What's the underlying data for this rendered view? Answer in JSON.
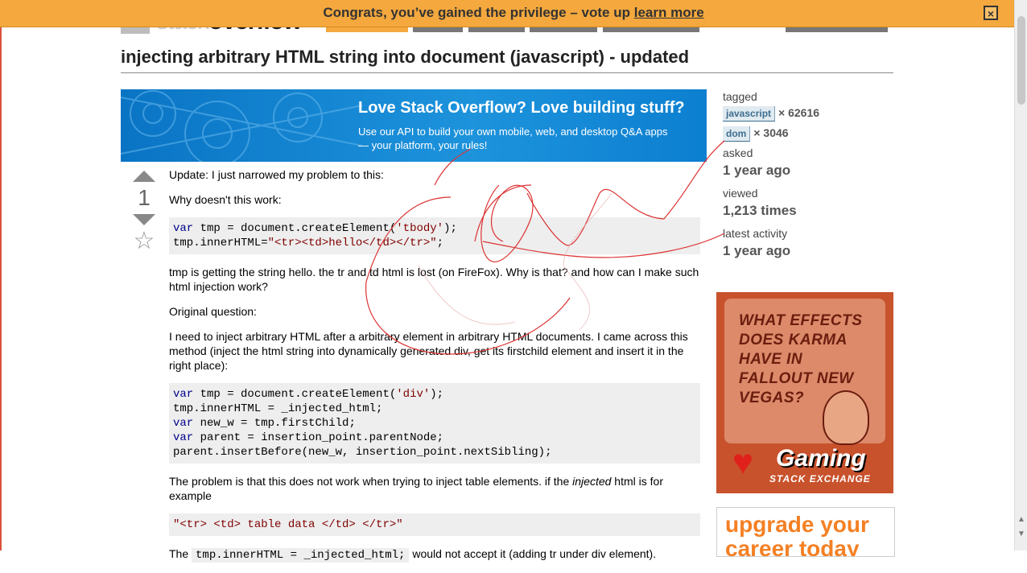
{
  "notification": {
    "message": "Congrats, you’ve gained the privilege – vote up",
    "link": "learn more",
    "close": "×"
  },
  "header": {
    "logo_prefix": "stack",
    "logo_suffix": "overflow"
  },
  "question": {
    "title": "injecting arbitrary HTML string into document (javascript) - updated",
    "votes": "1",
    "star": "☆"
  },
  "banner": {
    "headline": "Love Stack Overflow? Love building stuff?",
    "sub1": "Use our API to build your own mobile, web, and desktop Q&A apps",
    "sub2": "— your platform, your rules!"
  },
  "post": {
    "p1": "Update: I just narrowed my problem to this:",
    "p2": "Why doesn't this work:",
    "code1": {
      "l1_kw": "var",
      "l1_a": " tmp = document.createElement(",
      "l1_s": "'tbody'",
      "l1_b": ");",
      "l2_a": "tmp.innerHTML=",
      "l2_s": "\"<tr><td>hello</td></tr>\"",
      "l2_b": ";"
    },
    "p3": "tmp is getting the string hello. the tr and td html is lost (on FireFox). Why is that? and how can I make such html injection work?",
    "p4": "Original question:",
    "p5": "I need to inject arbitrary HTML after a arbitrary element in arbitrary HTML documents. I came across this method (inject the html string into dynamically generated div, get its firstchild element and insert it in the right place):",
    "code2": {
      "l1_kw": "var",
      "l1_a": " tmp = document.createElement(",
      "l1_s": "'div'",
      "l1_b": ");",
      "l2": "tmp.innerHTML = _injected_html;",
      "l3_kw": "var",
      "l3_a": " new_w = tmp.firstChild;",
      "l4_kw": "var",
      "l4_a": " parent = insertion_point.parentNode;",
      "l5": "parent.insertBefore(new_w, insertion_point.nextSibling);"
    },
    "p6_a": "The problem is that this does not work when trying to inject table elements. if the ",
    "p6_em": "injected",
    "p6_b": " html is for example",
    "code3": "\"<tr> <td> table data </td> </tr>\"",
    "p7_a": "The ",
    "p7_code": "tmp.innerHTML = _injected_html;",
    "p7_b": " would not accept it (adding tr under div element)."
  },
  "sidebar": {
    "tagged_label": "tagged",
    "tags": [
      {
        "name": "javascript",
        "count": "× 62616"
      },
      {
        "name": "dom",
        "count": "× 3046"
      }
    ],
    "asked_label": "asked",
    "asked_value": "1 year ago",
    "viewed_label": "viewed",
    "viewed_value": "1,213 times",
    "activity_label": "latest activity",
    "activity_value": "1 year ago"
  },
  "ads": {
    "gaming_question": "WHAT EFFECTS DOES KARMA HAVE IN FALLOUT NEW VEGAS?",
    "gaming_brand": "Gaming",
    "gaming_sub": "STACK EXCHANGE",
    "career": "upgrade your career today"
  },
  "colors": {
    "notify_bg": "#f4a83d",
    "banner_bg": "#1d93dc",
    "tag_bg": "#e0eaf1",
    "career_orange": "#f48024",
    "scribble": "#d33"
  }
}
